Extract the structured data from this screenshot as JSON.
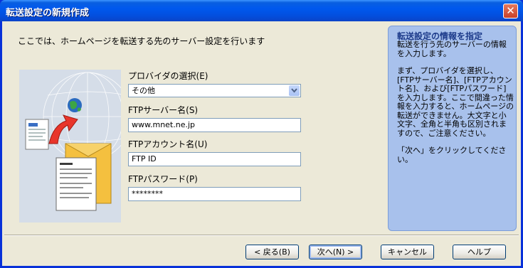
{
  "window": {
    "title": "転送設定の新規作成",
    "close_symbol": "✕"
  },
  "intro_text": "ここでは、ホームページを転送する先のサーバー設定を行います",
  "form": {
    "provider": {
      "label": "プロバイダの選択(E)",
      "value": "その他"
    },
    "server": {
      "label": "FTPサーバー名(S)",
      "value": "www.mnet.ne.jp"
    },
    "account": {
      "label": "FTPアカウント名(U)",
      "value": "FTP ID"
    },
    "password": {
      "label": "FTPパスワード(P)",
      "value": "********"
    }
  },
  "help": {
    "title": "転送設定の情報を指定",
    "paragraphs": [
      "転送を行う先のサーバーの情報を入力します。",
      "まず、プロバイダを選択し、[FTPサーバー名]、[FTPアカウント名]、および[FTPパスワード]を入力します。ここで間違った情報を入力すると、ホームページの転送ができません。大文字と小文字、全角と半角も区別されますので、ご注意ください。",
      "「次へ」をクリックしてください。"
    ]
  },
  "buttons": {
    "back": "< 戻る(B)",
    "next": "次へ(N) >",
    "cancel": "キャンセル",
    "help": "ヘルプ"
  },
  "colors": {
    "title_bar": "#0058ee",
    "dialog_bg": "#ece9d8",
    "help_panel": "#a8c1ec",
    "help_title": "#1c3a8a",
    "arrow": "#e8352b",
    "envelope": "#f4c03f"
  }
}
